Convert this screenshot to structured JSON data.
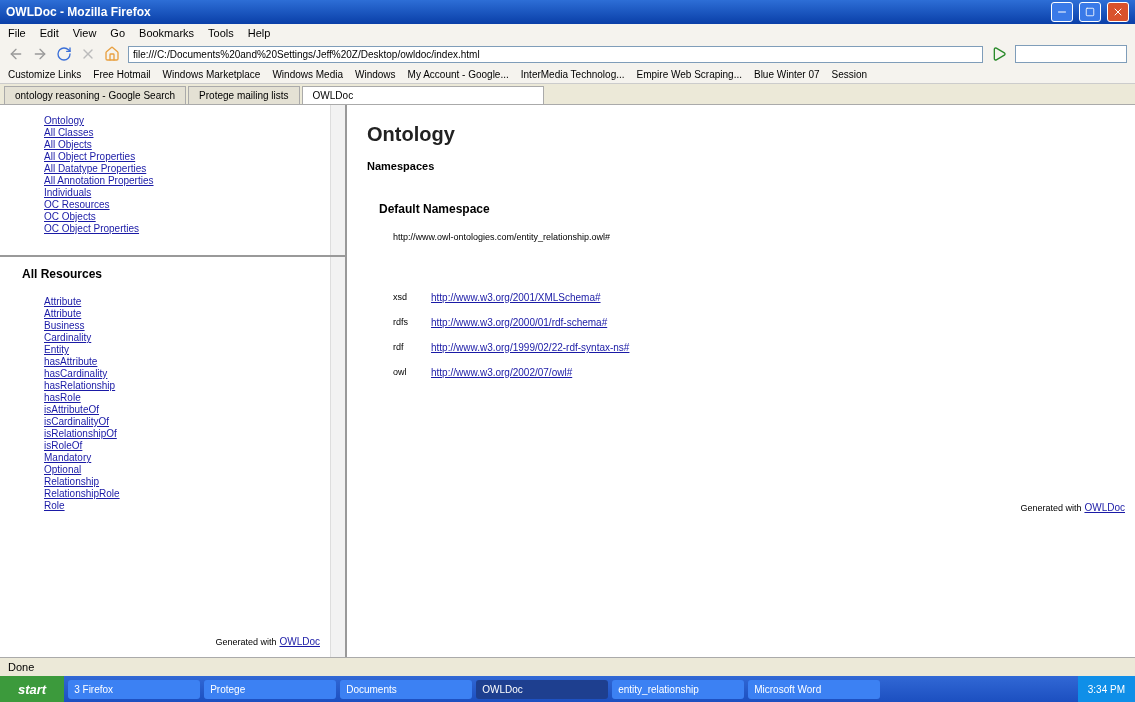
{
  "window": {
    "title": "OWLDoc - Mozilla Firefox"
  },
  "menu": [
    "File",
    "Edit",
    "View",
    "Go",
    "Bookmarks",
    "Tools",
    "Help"
  ],
  "address": {
    "value": "file:///C:/Documents%20and%20Settings/Jeff%20Z/Desktop/owldoc/index.html"
  },
  "bookmarks": [
    "Customize Links",
    "Free Hotmail",
    "Windows Marketplace",
    "Windows Media",
    "Windows",
    "My Account - Google...",
    "InterMedia Technolog...",
    "Empire Web Scraping...",
    "Blue Winter 07",
    "Session"
  ],
  "tabs": [
    {
      "label": "ontology reasoning - Google Search",
      "selected": false
    },
    {
      "label": "Protege mailing lists",
      "selected": false
    },
    {
      "label": "OWLDoc",
      "selected": true
    }
  ],
  "nav": {
    "items": [
      "Ontology",
      "All Classes",
      "All Objects",
      "All Object Properties",
      "All Datatype Properties",
      "All Annotation Properties",
      "Individuals",
      "OC Resources",
      "OC Objects",
      "OC Object Properties"
    ]
  },
  "resources": {
    "title": "All Resources",
    "items": [
      "Attribute",
      "Attribute",
      "Business",
      "Cardinality",
      "Entity",
      "hasAttribute",
      "hasCardinality",
      "hasRelationship",
      "hasRole",
      "isAttributeOf",
      "isCardinalityOf",
      "isRelationshipOf",
      "isRoleOf",
      "Mandatory",
      "Optional",
      "Relationship",
      "RelationshipRole",
      "Role"
    ],
    "footer_label": "Generated with",
    "footer_link": "OWLDoc"
  },
  "main": {
    "title": "Ontology",
    "section": "Namespaces",
    "subsection": "Default Namespace",
    "default_uri": "http://www.owl-ontologies.com/entity_relationship.owl#",
    "prefixes": [
      {
        "prefix": "xsd",
        "uri": "http://www.w3.org/2001/XMLSchema#"
      },
      {
        "prefix": "rdfs",
        "uri": "http://www.w3.org/2000/01/rdf-schema#"
      },
      {
        "prefix": "rdf",
        "uri": "http://www.w3.org/1999/02/22-rdf-syntax-ns#"
      },
      {
        "prefix": "owl",
        "uri": "http://www.w3.org/2002/07/owl#"
      }
    ],
    "footer_label": "Generated with",
    "footer_link": "OWLDoc"
  },
  "status_bar": "Done",
  "taskbar": {
    "start": "start",
    "items": [
      {
        "label": "3 Firefox",
        "selected": false
      },
      {
        "label": "Protege",
        "selected": false
      },
      {
        "label": "Documents",
        "selected": false
      },
      {
        "label": "OWLDoc",
        "selected": true
      },
      {
        "label": "entity_relationship",
        "selected": false
      },
      {
        "label": "Microsoft Word",
        "selected": false
      }
    ],
    "clock": "3:34 PM"
  }
}
